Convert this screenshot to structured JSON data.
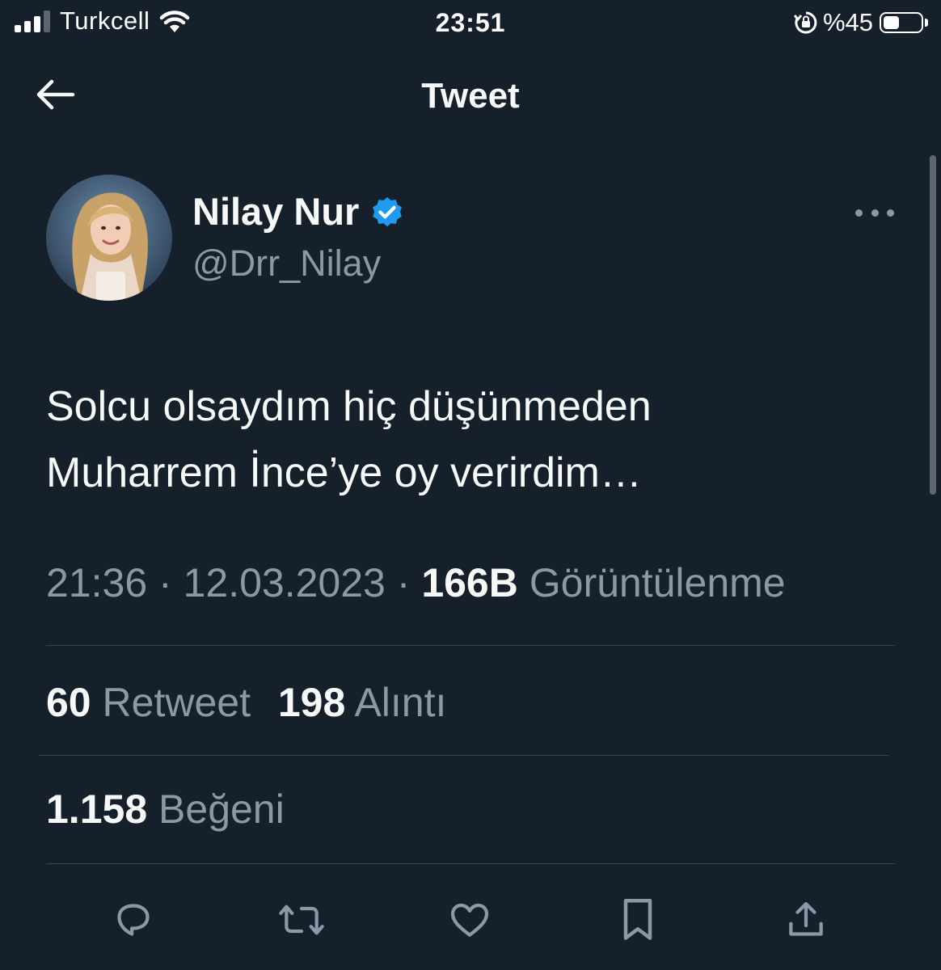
{
  "status_bar": {
    "carrier": "Turkcell",
    "time": "23:51",
    "battery": "%45",
    "battery_level": 0.45
  },
  "header": {
    "title": "Tweet"
  },
  "tweet": {
    "author": {
      "name": "Nilay Nur",
      "handle": "@Drr_Nilay",
      "verified": true
    },
    "text_lines": [
      "Solcu olsaydım hiç düşünmeden",
      "Muharrem İnce’ye oy verirdim…"
    ],
    "time": "21:36",
    "date": "12.03.2023",
    "separator": "·",
    "views_count": "166B",
    "views_label": "Görüntülenme",
    "retweets_count": "60",
    "retweets_label": "Retweet",
    "quotes_count": "198",
    "quotes_label": "Alıntı",
    "likes_count": "1.158",
    "likes_label": "Beğeni"
  },
  "colors": {
    "background": "#15202B",
    "text": "#F7F9F9",
    "secondary": "#8B98A5",
    "accent": "#1D9BF0",
    "divider": "#38444D"
  },
  "icons": [
    "back-arrow-icon",
    "verified-badge-icon",
    "more-icon",
    "reply-icon",
    "retweet-icon",
    "like-icon",
    "bookmark-icon",
    "share-icon"
  ]
}
